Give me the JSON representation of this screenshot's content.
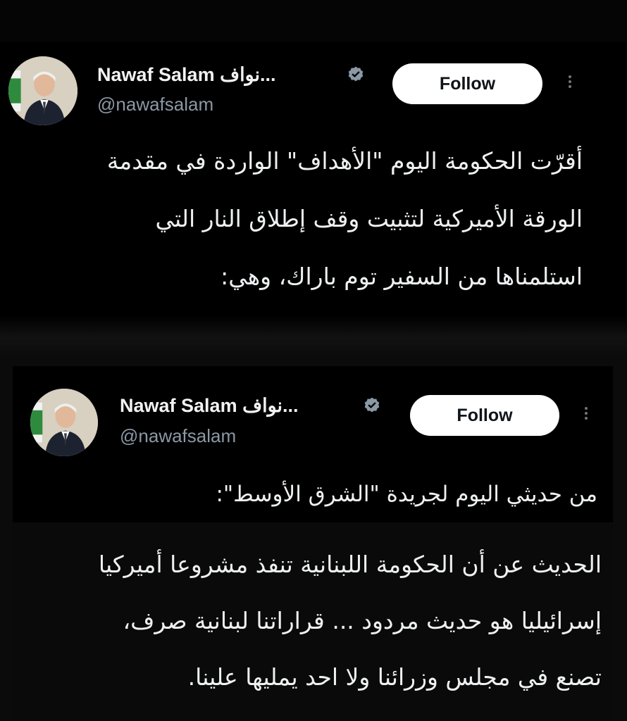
{
  "tweets": [
    {
      "display_name": "Nawaf Salam نواف...",
      "handle": "@nawafsalam",
      "follow_label": "Follow",
      "lines": [
        "أقرّت الحكومة اليوم \"الأهداف\" الواردة في مقدمة",
        "الورقة الأميركية لتثبيت وقف إطلاق النار التي",
        "استلمناها من السفير توم باراك، وهي:"
      ]
    },
    {
      "display_name": "Nawaf Salam نواف...",
      "handle": "@nawafsalam",
      "follow_label": "Follow",
      "lines": [
        "من حديثي اليوم لجريدة \"الشرق الأوسط\":"
      ]
    }
  ],
  "quote": {
    "lines": [
      "الحديث عن أن الحكومة اللبنانية تنفذ مشروعا أميركيا",
      "إسرائيليا هو حديث مردود ... قراراتنا لبنانية صرف،",
      "تصنع في مجلس وزرائنا ولا احد يمليها علينا."
    ]
  },
  "icons": {
    "verified": "verified-badge-icon",
    "more": "more-options-icon",
    "avatar": "profile-avatar"
  },
  "colors": {
    "background": "#000000",
    "text": "#e7e9ea",
    "muted": "#8b98a5",
    "follow_bg": "#ffffff"
  }
}
